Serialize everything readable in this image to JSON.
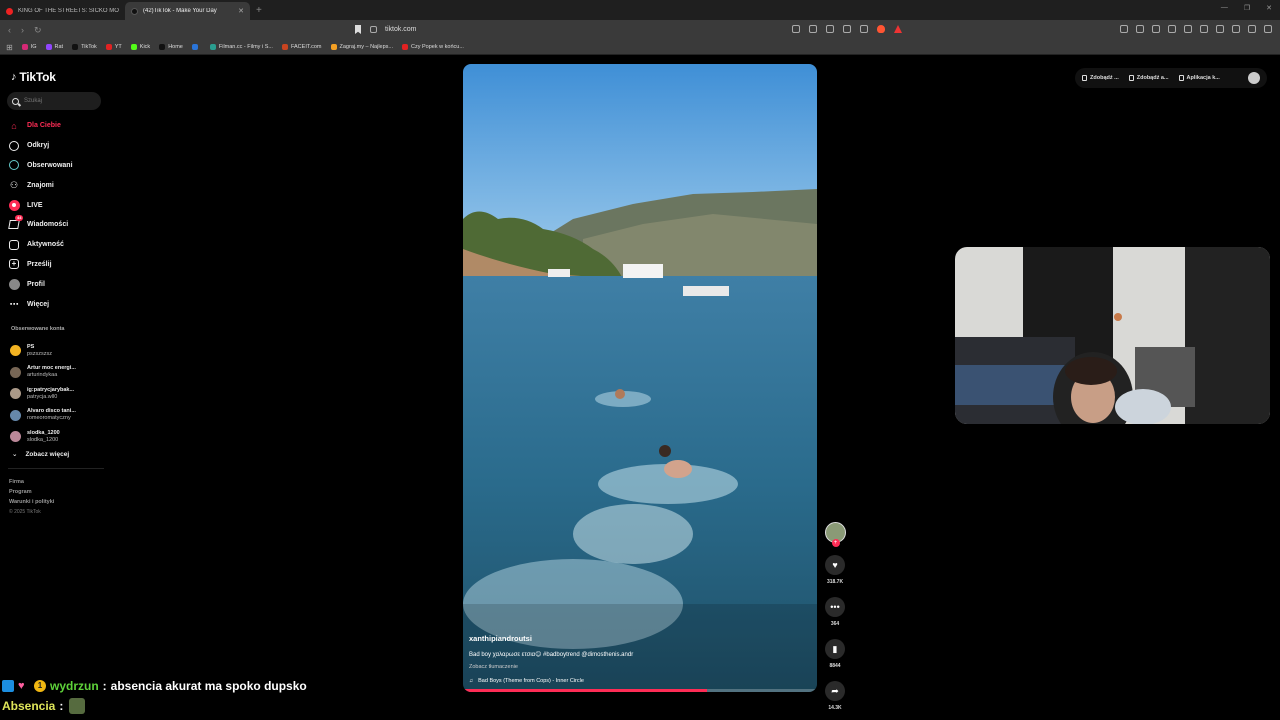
{
  "browser": {
    "tabs": [
      {
        "title": "KING OF THE STREETS: SICKO MODE"
      },
      {
        "title": "(42)TikTok - Make Your Day"
      }
    ],
    "url": "tiktok.com",
    "bookmarks": [
      "IG",
      "Rat",
      "TikTok",
      "YT",
      "Kick",
      "Home",
      "",
      "Filman.cc - Filmy i S...",
      "FACEIT.com",
      "Zagraj.my – Najleps...",
      "Czy Popek w końcu..."
    ],
    "bookmark_colors": [
      "#d62976",
      "#9146ff",
      "#111111",
      "#e22222",
      "#53fc18",
      "#111111",
      "#2a74d8",
      "#2a9d8f",
      "#c84420",
      "#f4a024",
      "#e22222"
    ]
  },
  "tiktok": {
    "logo": "TikTok",
    "search_placeholder": "Szukaj",
    "nav": [
      {
        "label": "Dla Ciebie",
        "icon": "home-icon"
      },
      {
        "label": "Odkryj",
        "icon": "compass-icon"
      },
      {
        "label": "Obserwowani",
        "icon": "following-icon"
      },
      {
        "label": "Znajomi",
        "icon": "friends-icon"
      },
      {
        "label": "LIVE",
        "icon": "live-icon"
      },
      {
        "label": "Wiadomości",
        "icon": "messages-icon",
        "badge": "44"
      },
      {
        "label": "Aktywność",
        "icon": "activity-icon"
      },
      {
        "label": "Prześlij",
        "icon": "upload-icon"
      },
      {
        "label": "Profil",
        "icon": "profile-icon"
      },
      {
        "label": "Więcej",
        "icon": "more-icon"
      }
    ],
    "followed_title": "Obserwowane konta",
    "followed": [
      {
        "name": "PS",
        "handle": "pszszszsz"
      },
      {
        "name": "Artur moc energi...",
        "handle": "arturindykaa"
      },
      {
        "name": "ig:patrycjarybak...",
        "handle": "patrycja.wll0"
      },
      {
        "name": "Alvaro disco tani...",
        "handle": "romeoromatyczny"
      },
      {
        "name": "slodka_1200",
        "handle": "slodka_1200"
      }
    ],
    "see_more": "Zobacz więcej",
    "footer": [
      "Firma",
      "Program",
      "Warunki i polityki"
    ],
    "copyright": "© 2025 TikTok",
    "top_actions": [
      "Zdobądź ...",
      "Zdobądź a...",
      "Aplikacja k..."
    ],
    "accent": "#fe2c55"
  },
  "video": {
    "author": "xanthipiandroutsi",
    "description": "Bad boy χαλαρωσε ετσια😊 #badboytrend @dimosthenis.andr",
    "see_translation": "Zobacz tłumaczenie",
    "music": "Bad Boys (Theme from Cops) - Inner Circle",
    "progress": 0.69,
    "likes": "318.7K",
    "comments": "364",
    "saves": "8844",
    "shares": "14.3K"
  },
  "chat": [
    {
      "user": "wydrzun",
      "sep": ":",
      "message": "absencia akurat ma spoko dupsko"
    },
    {
      "user": "Absencia",
      "sep": ":",
      "message": ""
    }
  ]
}
